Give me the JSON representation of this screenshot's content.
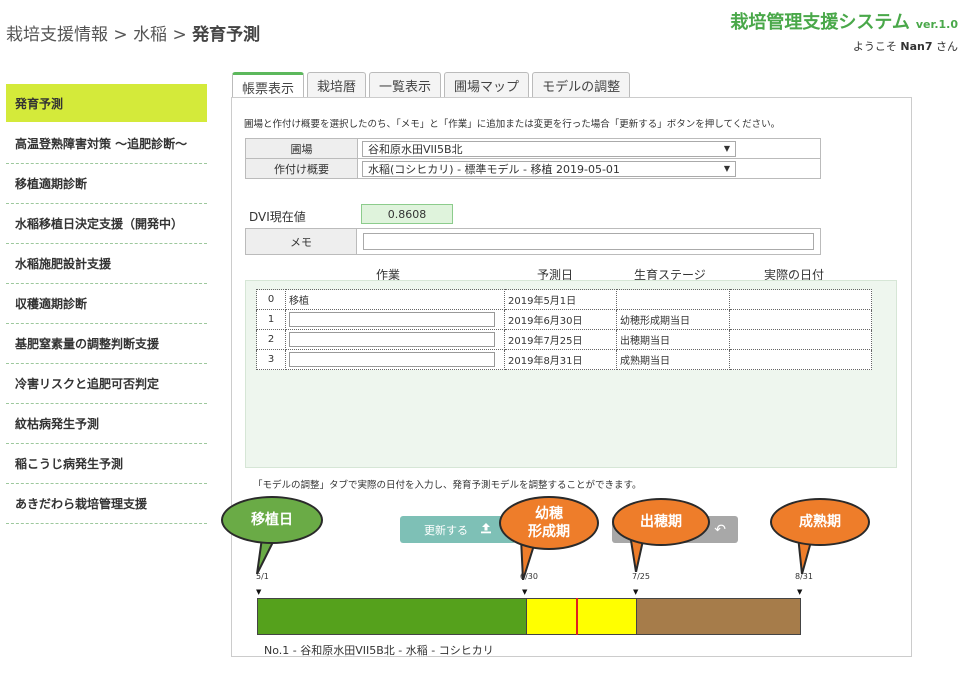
{
  "header": {
    "breadcrumb_parts": [
      "栽培支援情報",
      "水稲",
      "発育予測"
    ],
    "separator": ">",
    "app_title": "栽培管理支援システム",
    "version": "ver.1.0",
    "welcome_prefix": "ようこそ",
    "user_name": "Nan7",
    "welcome_suffix": "さん"
  },
  "sidebar": {
    "items": [
      {
        "label": "発育予測",
        "active": true
      },
      {
        "label": "高温登熟障害対策 ～追肥診断～"
      },
      {
        "label": "移植適期診断"
      },
      {
        "label": "水稲移植日決定支援（開発中）"
      },
      {
        "label": "水稲施肥設計支援"
      },
      {
        "label": "収穫適期診断"
      },
      {
        "label": "基肥窒素量の調整判断支援"
      },
      {
        "label": "冷害リスクと追肥可否判定"
      },
      {
        "label": "紋枯病発生予測"
      },
      {
        "label": "稲こうじ病発生予測"
      },
      {
        "label": "あきだわら栽培管理支援"
      }
    ]
  },
  "tabs": [
    {
      "label": "帳票表示",
      "active": true
    },
    {
      "label": "栽培暦"
    },
    {
      "label": "一覧表示"
    },
    {
      "label": "圃場マップ"
    },
    {
      "label": "モデルの調整"
    }
  ],
  "main": {
    "instruction": "圃場と作付け概要を選択したのち、「メモ」と「作業」に追加または変更を行った場合「更新する」ボタンを押してください。",
    "field_label": "圃場",
    "field_value": "谷和原水田VII5B北",
    "plan_label": "作付け概要",
    "plan_value": "水稲(コシヒカリ) - 標準モデル - 移植 2019-05-01",
    "dvi_label": "DVI現在値",
    "dvi_value": "0.8608",
    "memo_label": "メモ",
    "memo_value": "",
    "columns": [
      "作業",
      "予測日",
      "生育ステージ",
      "実際の日付"
    ],
    "rows": [
      {
        "no": "0",
        "work": "移植",
        "date": "2019年5月1日",
        "stage": "",
        "actual": ""
      },
      {
        "no": "1",
        "work": "",
        "date": "2019年6月30日",
        "stage": "幼穂形成期当日",
        "actual": ""
      },
      {
        "no": "2",
        "work": "",
        "date": "2019年7月25日",
        "stage": "出穂期当日",
        "actual": ""
      },
      {
        "no": "3",
        "work": "",
        "date": "2019年8月31日",
        "stage": "成熟期当日",
        "actual": ""
      }
    ],
    "note": "「モデルの調整」タブで実際の日付を入力し、発育予測モデルを調整することができます。",
    "update_button": "更新する",
    "update_icon": "upload-icon",
    "back_icon": "undo-icon"
  },
  "timeline": {
    "dates": [
      "5/1",
      "6/30",
      "7/25",
      "8/31"
    ],
    "current_marker_fraction": 0.586,
    "caption": "No.1 - 谷和原水田VII5B北 - 水稲 - コシヒカリ",
    "colors": {
      "vegetative": "#55a11c",
      "panicle": "#ffff00",
      "ripening": "#a67c4a",
      "marker": "#e02020"
    }
  },
  "callouts": [
    {
      "text": "移植日",
      "color": "#6aab46"
    },
    {
      "text": "幼穂\n形成期",
      "color": "#ee7d2a"
    },
    {
      "text": "出穂期",
      "color": "#ee7d2a"
    },
    {
      "text": "成熟期",
      "color": "#ee7d2a"
    }
  ]
}
